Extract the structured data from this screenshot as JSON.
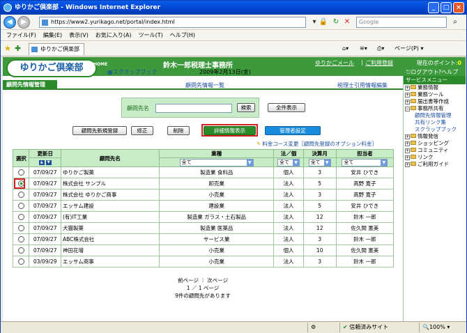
{
  "window": {
    "title": "ゆりかご倶楽部 - Windows Internet Explorer"
  },
  "address": {
    "url": "https://www2.yurikago.net/portal/index.html",
    "search_placeholder": "Google"
  },
  "menu": [
    "ファイル(F)",
    "編集(E)",
    "表示(V)",
    "お気に入り(A)",
    "ツール(T)",
    "ヘルプ(H)"
  ],
  "favbar": {
    "tab": "ゆりかご倶楽部",
    "page_label": "ページ(P) ▾"
  },
  "header": {
    "logo": "ゆりかご倶楽部",
    "home": "HOME",
    "firm": "鈴木一郎税理士事務所",
    "mail": "ゆりかごメール",
    "register": "ご利用登録",
    "points_label": "現在のポイント:",
    "points": "0"
  },
  "subheader": {
    "scrapbook": "スクラップブック",
    "date": "2009年2月13日(金)",
    "logout": "ログアウト",
    "help": "ヘルプ"
  },
  "section": {
    "title": "顧問先情報管理",
    "center_link": "顧問先情報一覧",
    "right_link": "税理士引用情報編集"
  },
  "search": {
    "label": "顧問先名",
    "button": "検索",
    "show_all": "全件表示"
  },
  "actions": {
    "new": "顧問先新規登録",
    "edit": "修正",
    "delete": "削除",
    "detail": "詳細情報表示",
    "manager": "管理者設定"
  },
  "course_link": "料金コース変更［顧問先登録のオプション料金］",
  "table": {
    "headers": {
      "select": "選択",
      "updated": "更新日",
      "name": "顧問先名",
      "industry": "業種",
      "type": "法／個",
      "month": "決算月",
      "staff": "担当者"
    },
    "filters": {
      "industry": "全て",
      "type": "全て",
      "month": "全て",
      "staff": "全て"
    },
    "rows": [
      {
        "date": "07/09/27",
        "name": "ゆりかご製菓",
        "industry": "製造業 食料品",
        "type": "個人",
        "month": "3",
        "staff": "安井 ひでき",
        "selected": false
      },
      {
        "date": "07/09/27",
        "name": "株式会社 サンプル",
        "industry": "卸売業",
        "type": "法人",
        "month": "5",
        "staff": "高野 寛子",
        "selected": true
      },
      {
        "date": "07/09/27",
        "name": "株式会社 ゆりかご商事",
        "industry": "小売業",
        "type": "法人",
        "month": "3",
        "staff": "高野 寛子",
        "selected": false
      },
      {
        "date": "07/09/27",
        "name": "エッサム建設",
        "industry": "建設業",
        "type": "法人",
        "month": "5",
        "staff": "安井 ひでき",
        "selected": false
      },
      {
        "date": "07/09/27",
        "name": "(有)IT工業",
        "industry": "製造業 ガラス・土石製品",
        "type": "法人",
        "month": "12",
        "staff": "鈴木 一郎",
        "selected": false
      },
      {
        "date": "07/09/27",
        "name": "犬猫製薬",
        "industry": "製造業 医薬品",
        "type": "法人",
        "month": "12",
        "staff": "佐久間 憲美",
        "selected": false
      },
      {
        "date": "07/09/27",
        "name": "ABC株式会社",
        "industry": "サービス業",
        "type": "法人",
        "month": "3",
        "staff": "鈴木 一郎",
        "selected": false
      },
      {
        "date": "07/09/27",
        "name": "神田花増",
        "industry": "小売業",
        "type": "個人",
        "month": "10",
        "staff": "佐久間 憲美",
        "selected": false
      },
      {
        "date": "03/09/29",
        "name": "エッサム商事",
        "industry": "小売業",
        "type": "法人",
        "month": "3",
        "staff": "鈴木 一郎",
        "selected": false
      }
    ]
  },
  "pager": {
    "nav": "前ページ ｜ 次ページ",
    "page": "1 ／ 1 ページ",
    "count": "9件の顧問先があります"
  },
  "sidebar": {
    "title": "サービスメニュー",
    "items": [
      "業務情報",
      "業務ツール",
      "届出書等作成",
      "事務所共有",
      "情報発信",
      "ショッピング",
      "コミュニティ",
      "リンク",
      "ご利用ガイド"
    ],
    "subitems": [
      "顧問先情報管理",
      "共有リンク集",
      "スクラップブック"
    ]
  },
  "status": {
    "trusted": "信頼済みサイト",
    "zoom": "100%"
  }
}
